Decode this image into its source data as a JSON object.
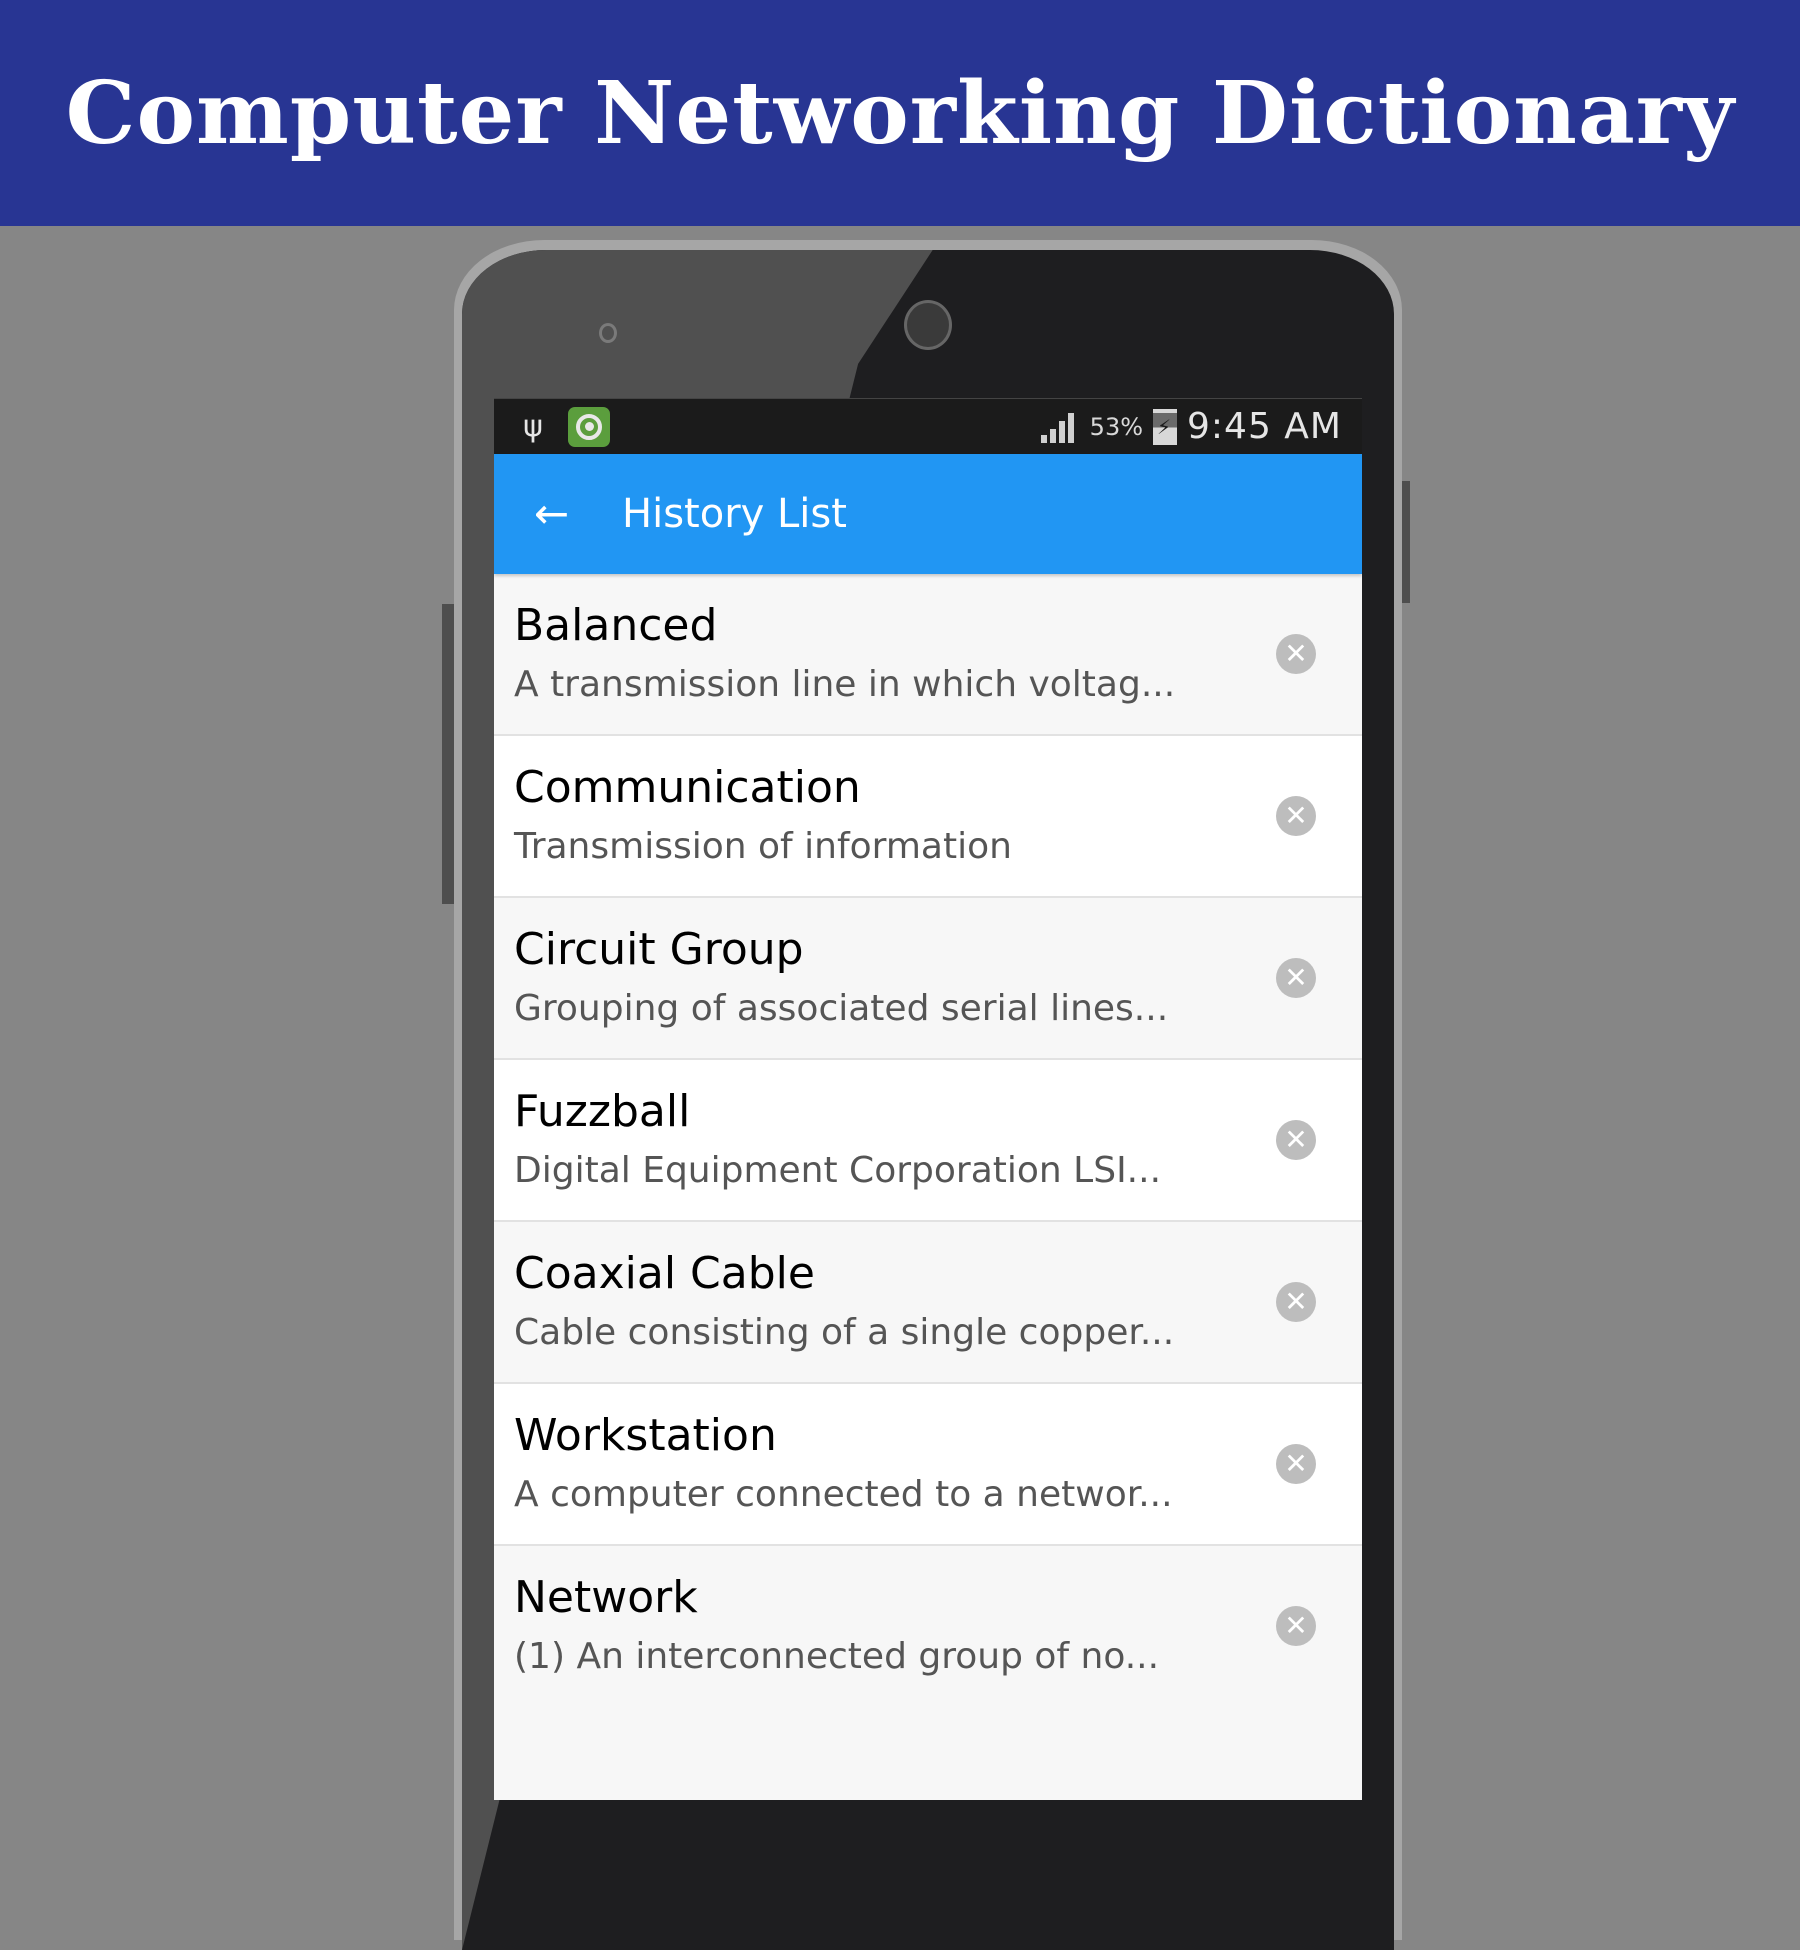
{
  "banner": {
    "title": "Computer Networking Dictionary"
  },
  "status_bar": {
    "usb_icon": "usb-icon",
    "app_icon": "target-app-icon",
    "signal_icon": "signal-icon",
    "battery_percent": "53%",
    "battery_icon": "battery-charging-icon",
    "time": "9:45 AM"
  },
  "toolbar": {
    "back_icon": "arrow-left-icon",
    "title": "History List"
  },
  "history": [
    {
      "term": "Balanced",
      "definition": "A transmission line in which voltag..."
    },
    {
      "term": "Communication",
      "definition": "Transmission of information"
    },
    {
      "term": "Circuit Group",
      "definition": "Grouping of associated serial lines..."
    },
    {
      "term": "Fuzzball",
      "definition": "Digital Equipment Corporation LSI..."
    },
    {
      "term": "Coaxial Cable",
      "definition": "Cable consisting of a single copper..."
    },
    {
      "term": "Workstation",
      "definition": "A computer connected to a networ..."
    },
    {
      "term": "Network",
      "definition": "(1) An interconnected group of no..."
    }
  ],
  "colors": {
    "banner_bg": "#283593",
    "toolbar_bg": "#2196f3",
    "remove_icon": "#bdbdbd"
  }
}
